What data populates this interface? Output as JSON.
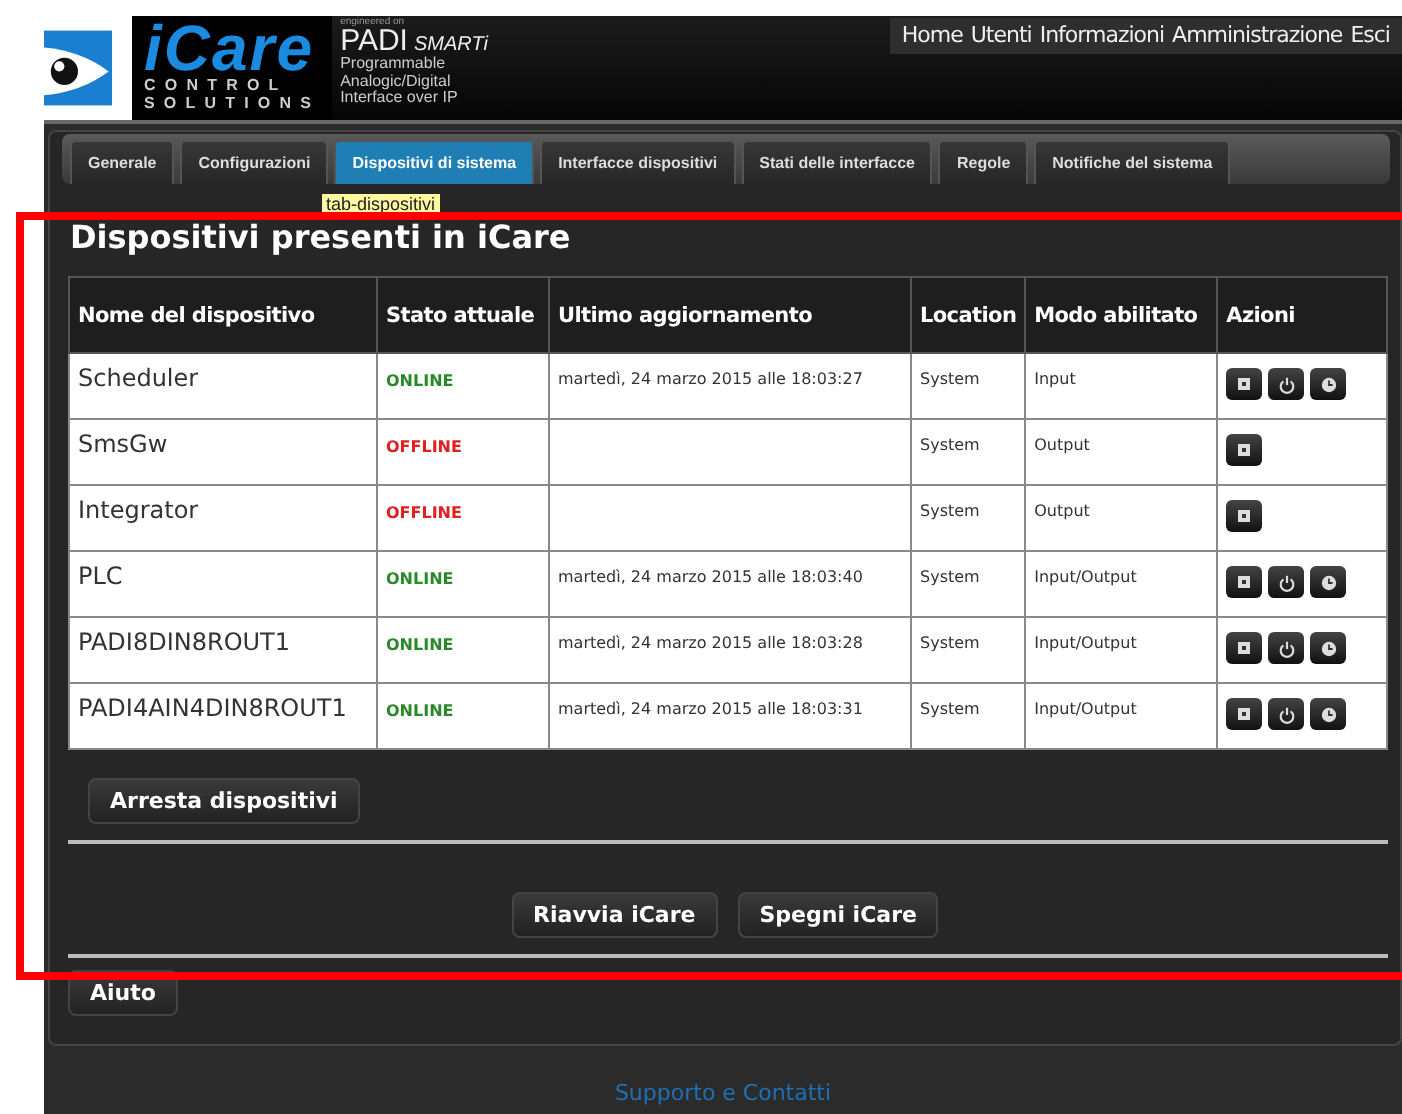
{
  "logo": {
    "name": "iCare",
    "tagline": "CONTROL",
    "tagline_2": "SOLUTIONS",
    "engineered": "engineered on",
    "product": "PADI",
    "product_sub": "SMARTi",
    "description": [
      "Programmable",
      "Analogic/Digital",
      "Interface over IP"
    ]
  },
  "top_nav": [
    "Home",
    "Utenti",
    "Informazioni",
    "Amministrazione",
    "Esci"
  ],
  "tabs": [
    {
      "label": "Generale",
      "selected": false
    },
    {
      "label": "Configurazioni",
      "selected": false
    },
    {
      "label": "Dispositivi di sistema",
      "selected": true
    },
    {
      "label": "Interfacce dispositivi",
      "selected": false
    },
    {
      "label": "Stati delle interfacce",
      "selected": false
    },
    {
      "label": "Regole",
      "selected": false
    },
    {
      "label": "Notifiche del sistema",
      "selected": false
    }
  ],
  "tooltip": "tab-dispositivi",
  "heading": "Dispositivi presenti in iCare",
  "table": {
    "columns": [
      "Nome del dispositivo",
      "Stato attuale",
      "Ultimo aggiornamento",
      "Location",
      "Modo abilitato",
      "Azioni"
    ],
    "rows": [
      {
        "name": "Scheduler",
        "status": "ONLINE",
        "online": true,
        "updated": "martedì, 24 marzo 2015 alle 18:03:27",
        "location": "System",
        "mode": "Input",
        "actions": [
          {
            "kind": "stop"
          },
          {
            "kind": "power"
          },
          {
            "kind": "clock"
          }
        ]
      },
      {
        "name": "SmsGw",
        "status": "OFFLINE",
        "online": false,
        "location": "System",
        "mode": "Output",
        "actions": [
          {
            "kind": "stop"
          }
        ]
      },
      {
        "name": "Integrator",
        "status": "OFFLINE",
        "online": false,
        "location": "System",
        "mode": "Output",
        "actions": [
          {
            "kind": "stop"
          }
        ]
      },
      {
        "name": "PLC",
        "status": "ONLINE",
        "online": true,
        "updated": "martedì, 24 marzo 2015 alle 18:03:40",
        "location": "System",
        "mode": "Input/Output",
        "actions": [
          {
            "kind": "stop"
          },
          {
            "kind": "power"
          },
          {
            "kind": "clock"
          }
        ]
      },
      {
        "name": "PADI8DIN8ROUT1",
        "status": "ONLINE",
        "online": true,
        "updated": "martedì, 24 marzo 2015 alle 18:03:28",
        "location": "System",
        "mode": "Input/Output",
        "actions": [
          {
            "kind": "stop"
          },
          {
            "kind": "power"
          },
          {
            "kind": "clock"
          }
        ]
      },
      {
        "name": "PADI4AIN4DIN8ROUT1",
        "status": "ONLINE",
        "online": true,
        "updated": "martedì, 24 marzo 2015 alle 18:03:31",
        "location": "System",
        "mode": "Input/Output",
        "actions": [
          {
            "kind": "stop"
          },
          {
            "kind": "power"
          },
          {
            "kind": "clock"
          }
        ]
      }
    ]
  },
  "buttons": {
    "stop_devices": "Arresta dispositivi",
    "restart": "Riavvia iCare",
    "shutdown": "Spegni iCare",
    "help": "Aiuto"
  },
  "footer_link": "Supporto e Contatti"
}
